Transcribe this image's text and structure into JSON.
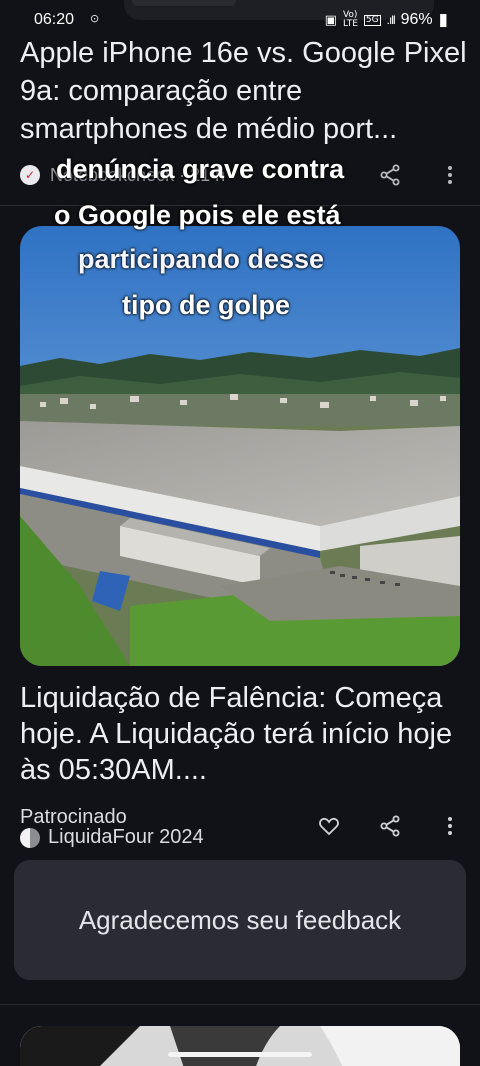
{
  "status_bar": {
    "time": "06:20",
    "record_icon": "record-icon",
    "signal_labels": [
      "Vo)",
      "LTE",
      "5G"
    ],
    "battery": "96%"
  },
  "article1": {
    "title": "Apple iPhone 16e vs. Google Pixel 9a: comparação entre smartphones de médio port...",
    "source": "Notebookcheck · 21 h"
  },
  "overlay_caption": {
    "line1": "denúncia grave contra",
    "line2": "o Google pois ele está",
    "line3": "participando desse",
    "line4": "tipo de golpe"
  },
  "article2": {
    "title": "Liquidação de Falência: Começa hoje. A Liquidação terá início hoje às 05:30AM....",
    "sponsored_label": "Patrocinado",
    "source": "LiquidaFour 2024"
  },
  "feedback": {
    "text": "Agradecemos seu feedback"
  },
  "colors": {
    "background": "#111217",
    "card": "#2b2c33",
    "text": "#eceef2"
  }
}
